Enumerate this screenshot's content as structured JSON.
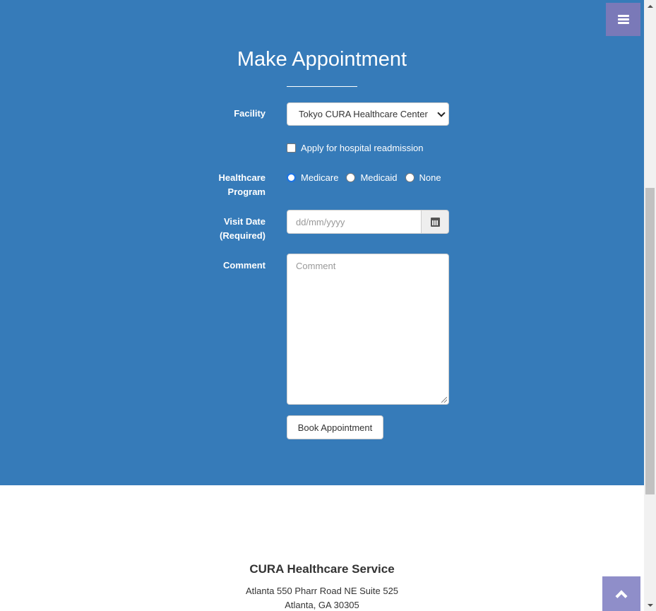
{
  "colors": {
    "section_bg": "#367bb9",
    "menu_button": "#7a79b8",
    "to_top_button": "#8f8ec9",
    "radio_checked": "#1a73e8"
  },
  "menu": {
    "icon": "hamburger-icon"
  },
  "form": {
    "title": "Make Appointment",
    "facility": {
      "label": "Facility",
      "selected": "Tokyo CURA Healthcare Center"
    },
    "readmission": {
      "label": "Apply for hospital readmission",
      "checked": false
    },
    "program": {
      "label_line1": "Healthcare",
      "label_line2": "Program",
      "options": [
        "Medicare",
        "Medicaid",
        "None"
      ],
      "selected": "Medicare"
    },
    "visit_date": {
      "label_line1": "Visit Date",
      "label_line2": "(Required)",
      "placeholder": "dd/mm/yyyy",
      "icon": "calendar-icon"
    },
    "comment": {
      "label": "Comment",
      "placeholder": "Comment"
    },
    "submit_label": "Book Appointment"
  },
  "footer": {
    "title": "CURA Healthcare Service",
    "address_line1": "Atlanta 550 Pharr Road NE Suite 525",
    "address_line2": "Atlanta, GA 30305"
  },
  "to_top": {
    "icon": "chevron-up-icon"
  }
}
